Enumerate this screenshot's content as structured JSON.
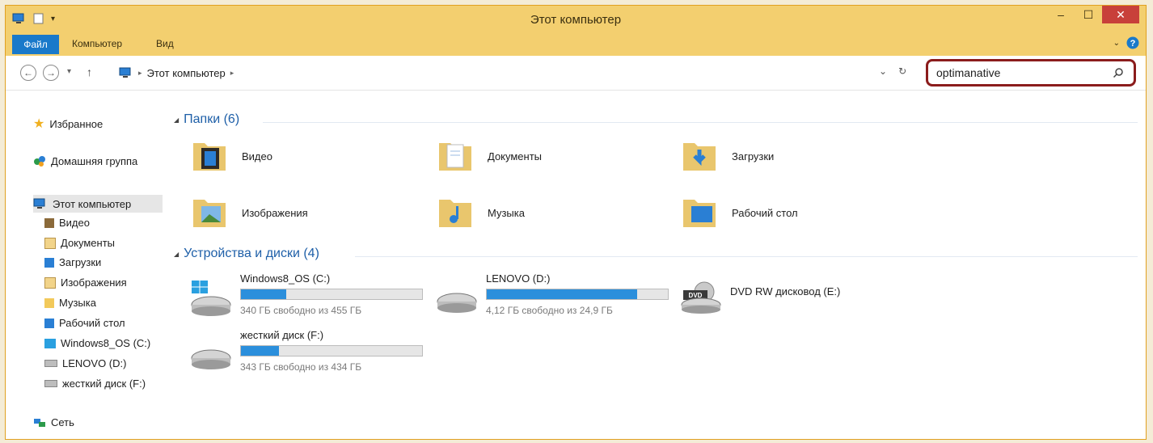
{
  "window": {
    "title": "Этот компьютер"
  },
  "ribbon": {
    "file_tab": "Файл",
    "tab_computer": "Компьютер",
    "tab_view": "Вид"
  },
  "address": {
    "location": "Этот компьютер"
  },
  "search": {
    "value": "optimanative"
  },
  "sidebar": {
    "favorites": "Избранное",
    "homegroup": "Домашняя группа",
    "this_pc": "Этот компьютер",
    "items": [
      "Видео",
      "Документы",
      "Загрузки",
      "Изображения",
      "Музыка",
      "Рабочий стол",
      "Windows8_OS (C:)",
      "LENOVO (D:)",
      "жесткий диск (F:)"
    ],
    "network": "Сеть"
  },
  "main": {
    "folders_header": "Папки (6)",
    "folders": [
      "Видео",
      "Документы",
      "Загрузки",
      "Изображения",
      "Музыка",
      "Рабочий стол"
    ],
    "devices_header": "Устройства и диски (4)",
    "drives": [
      {
        "name": "Windows8_OS (C:)",
        "free": "340 ГБ свободно из 455 ГБ",
        "used_fraction": 0.25
      },
      {
        "name": "LENOVO (D:)",
        "free": "4,12 ГБ свободно из 24,9 ГБ",
        "used_fraction": 0.83
      },
      {
        "name": "жесткий диск (F:)",
        "free": "343 ГБ свободно из 434 ГБ",
        "used_fraction": 0.21
      },
      {
        "name": "DVD RW дисковод (E:)"
      }
    ]
  },
  "colors": {
    "titlebar": "#f3cf6f",
    "accent": "#1979ca",
    "search_highlight": "#8b1c1c",
    "drive_fill": "#2b8fdc"
  }
}
